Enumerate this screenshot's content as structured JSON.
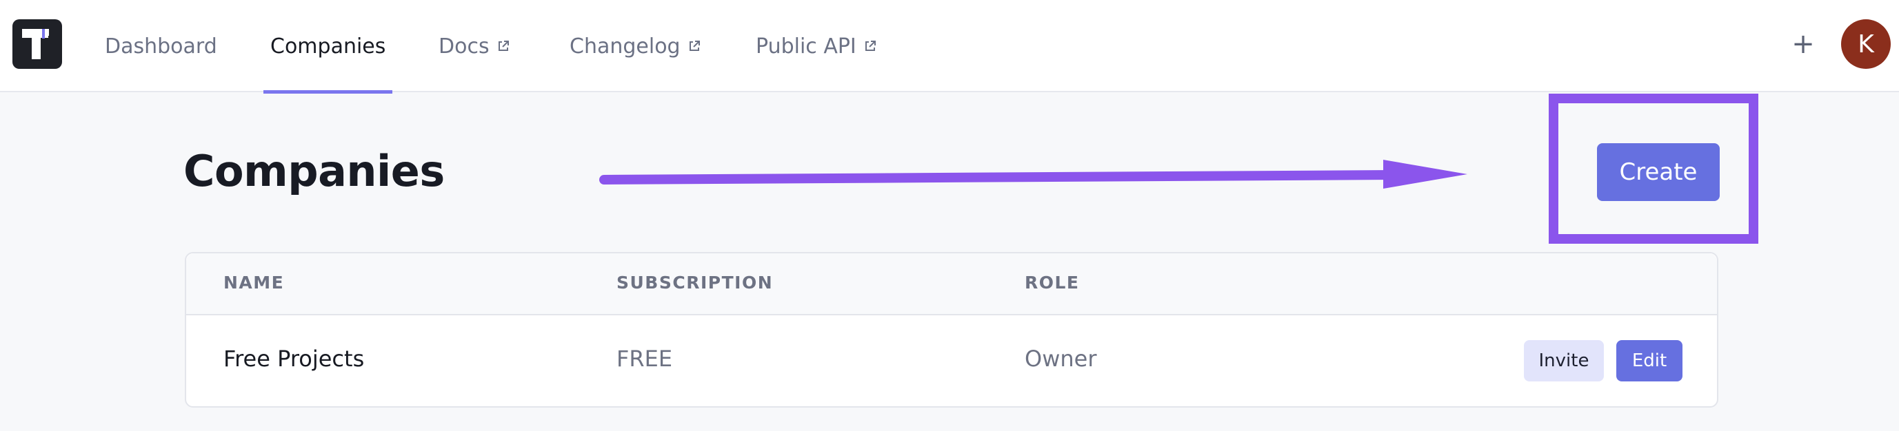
{
  "nav": {
    "items": [
      {
        "label": "Dashboard",
        "external": false,
        "active": false
      },
      {
        "label": "Companies",
        "external": false,
        "active": true
      },
      {
        "label": "Docs",
        "external": true,
        "active": false
      },
      {
        "label": "Changelog",
        "external": true,
        "active": false
      },
      {
        "label": "Public API",
        "external": true,
        "active": false
      }
    ],
    "plus_label": "+",
    "avatar_initial": "K"
  },
  "main": {
    "title": "Companies",
    "create_label": "Create"
  },
  "table": {
    "columns": [
      "NAME",
      "SUBSCRIPTION",
      "ROLE"
    ],
    "rows": [
      {
        "name": "Free Projects",
        "subscription": "FREE",
        "role": "Owner",
        "actions": {
          "invite": "Invite",
          "edit": "Edit"
        }
      }
    ]
  },
  "colors": {
    "accent": "#6670e0",
    "annotation": "#8b55ec",
    "avatar_bg": "#8b2e1c",
    "logo_bg": "#1f2127"
  }
}
